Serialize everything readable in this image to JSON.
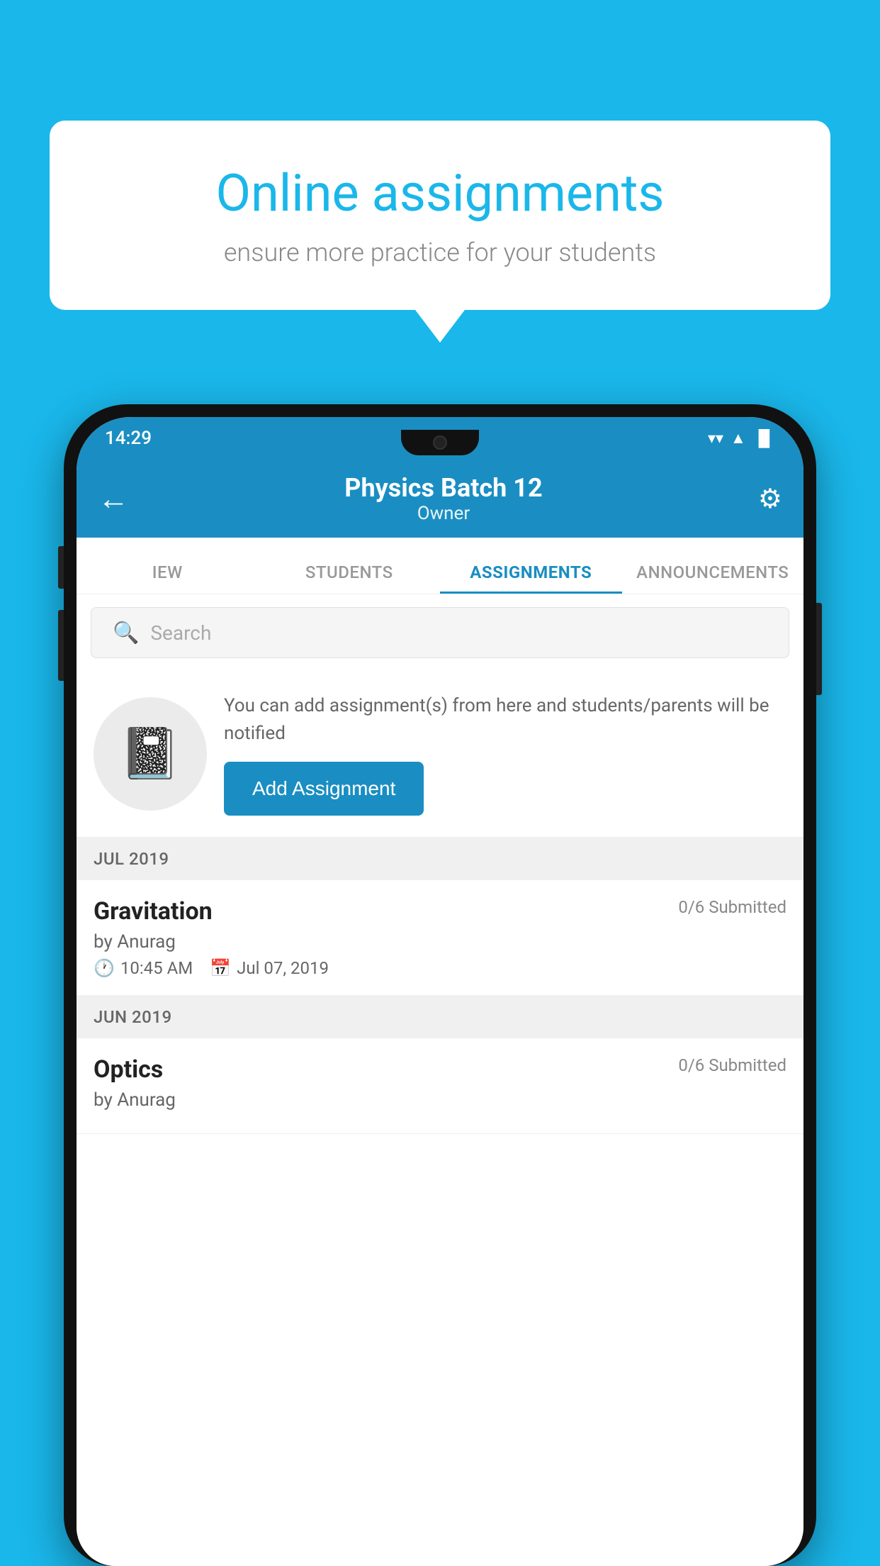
{
  "background_color": "#1ab7ea",
  "speech_bubble": {
    "title": "Online assignments",
    "subtitle": "ensure more practice for your students"
  },
  "status_bar": {
    "time": "14:29",
    "wifi_icon": "▼",
    "signal_icon": "▲",
    "battery_icon": "▐"
  },
  "header": {
    "title": "Physics Batch 12",
    "subtitle": "Owner",
    "back_label": "←",
    "settings_label": "⚙"
  },
  "tabs": [
    {
      "id": "iew",
      "label": "IEW",
      "active": false
    },
    {
      "id": "students",
      "label": "STUDENTS",
      "active": false
    },
    {
      "id": "assignments",
      "label": "ASSIGNMENTS",
      "active": true
    },
    {
      "id": "announcements",
      "label": "ANNOUNCEMENTS",
      "active": false
    }
  ],
  "search": {
    "placeholder": "Search"
  },
  "promo": {
    "description": "You can add assignment(s) from here and students/parents will be notified",
    "button_label": "Add Assignment"
  },
  "sections": [
    {
      "month_label": "JUL 2019",
      "assignments": [
        {
          "title": "Gravitation",
          "submitted": "0/6 Submitted",
          "author": "by Anurag",
          "time": "10:45 AM",
          "date": "Jul 07, 2019"
        }
      ]
    },
    {
      "month_label": "JUN 2019",
      "assignments": [
        {
          "title": "Optics",
          "submitted": "0/6 Submitted",
          "author": "by Anurag",
          "time": "",
          "date": ""
        }
      ]
    }
  ]
}
